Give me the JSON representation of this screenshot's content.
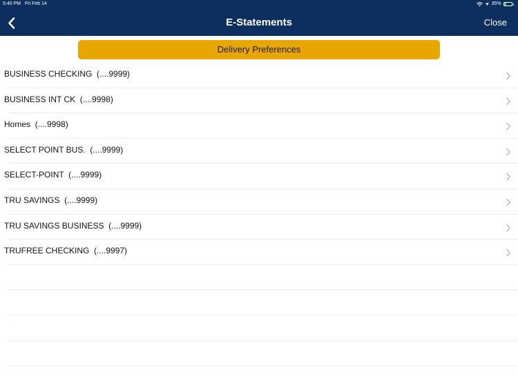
{
  "status_bar": {
    "time": "5:40 PM",
    "date": "Fri Feb 14",
    "battery_percent": "35%",
    "battery_level": 0.35,
    "icons": [
      "wifi-icon",
      "location-icon",
      "battery-icon"
    ]
  },
  "nav": {
    "back_icon": "chevron-left-icon",
    "title": "E-Statements",
    "close_label": "Close"
  },
  "delivery_button_label": "Delivery Preferences",
  "accounts": [
    {
      "label": "BUSINESS CHECKING  (....9999)"
    },
    {
      "label": "BUSINESS INT CK  (....9998)"
    },
    {
      "label": "Homes  (....9998)"
    },
    {
      "label": "SELECT POINT BUS.  (....9999)"
    },
    {
      "label": "SELECT-POINT  (....9999)"
    },
    {
      "label": "TRU SAVINGS  (....9999)"
    },
    {
      "label": "TRU SAVINGS BUSINESS  (....9999)"
    },
    {
      "label": "TRUFREE CHECKING  (....9997)"
    }
  ],
  "colors": {
    "header": "#0d2f5f",
    "accent_button": "#e8a600",
    "battery": "#36c759"
  }
}
